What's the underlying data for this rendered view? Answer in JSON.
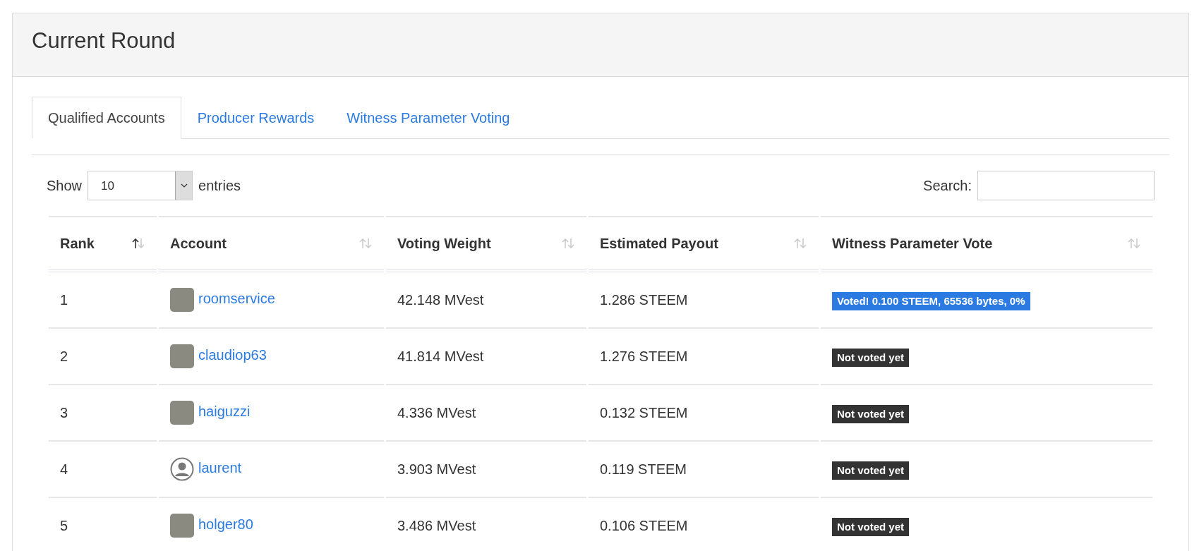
{
  "card": {
    "title": "Current Round"
  },
  "tabs": [
    {
      "label": "Qualified Accounts",
      "selected": true
    },
    {
      "label": "Producer Rewards",
      "selected": false
    },
    {
      "label": "Witness Parameter Voting",
      "selected": false
    }
  ],
  "length_control": {
    "label_before": "Show",
    "value": "10",
    "label_after": "entries"
  },
  "search": {
    "label": "Search:"
  },
  "table": {
    "columns": [
      {
        "label": "Rank",
        "sorted": true
      },
      {
        "label": "Account",
        "sorted": false
      },
      {
        "label": "Voting Weight",
        "sorted": false
      },
      {
        "label": "Estimated Payout",
        "sorted": false
      },
      {
        "label": "Witness Parameter Vote",
        "sorted": false
      }
    ],
    "rows": [
      {
        "rank": "1",
        "avatar": {
          "kind": "photo"
        },
        "account": "roomservice",
        "weight": "42.148 MVest",
        "payout": "1.286 STEEM",
        "vote": {
          "kind": "voted",
          "text": "Voted! 0.100 STEEM, 65536 bytes, 0%"
        }
      },
      {
        "rank": "2",
        "avatar": {
          "kind": "photo"
        },
        "account": "claudiop63",
        "weight": "41.814 MVest",
        "payout": "1.276 STEEM",
        "vote": {
          "kind": "not-voted",
          "text": "Not voted yet"
        }
      },
      {
        "rank": "3",
        "avatar": {
          "kind": "photo"
        },
        "account": "haiguzzi",
        "weight": "4.336 MVest",
        "payout": "0.132 STEEM",
        "vote": {
          "kind": "not-voted",
          "text": "Not voted yet"
        }
      },
      {
        "rank": "4",
        "avatar": {
          "kind": "default"
        },
        "account": "laurent",
        "weight": "3.903 MVest",
        "payout": "0.119 STEEM",
        "vote": {
          "kind": "not-voted",
          "text": "Not voted yet"
        }
      },
      {
        "rank": "5",
        "avatar": {
          "kind": "photo"
        },
        "account": "holger80",
        "weight": "3.486 MVest",
        "payout": "0.106 STEEM",
        "vote": {
          "kind": "not-voted",
          "text": "Not voted yet"
        }
      }
    ]
  }
}
